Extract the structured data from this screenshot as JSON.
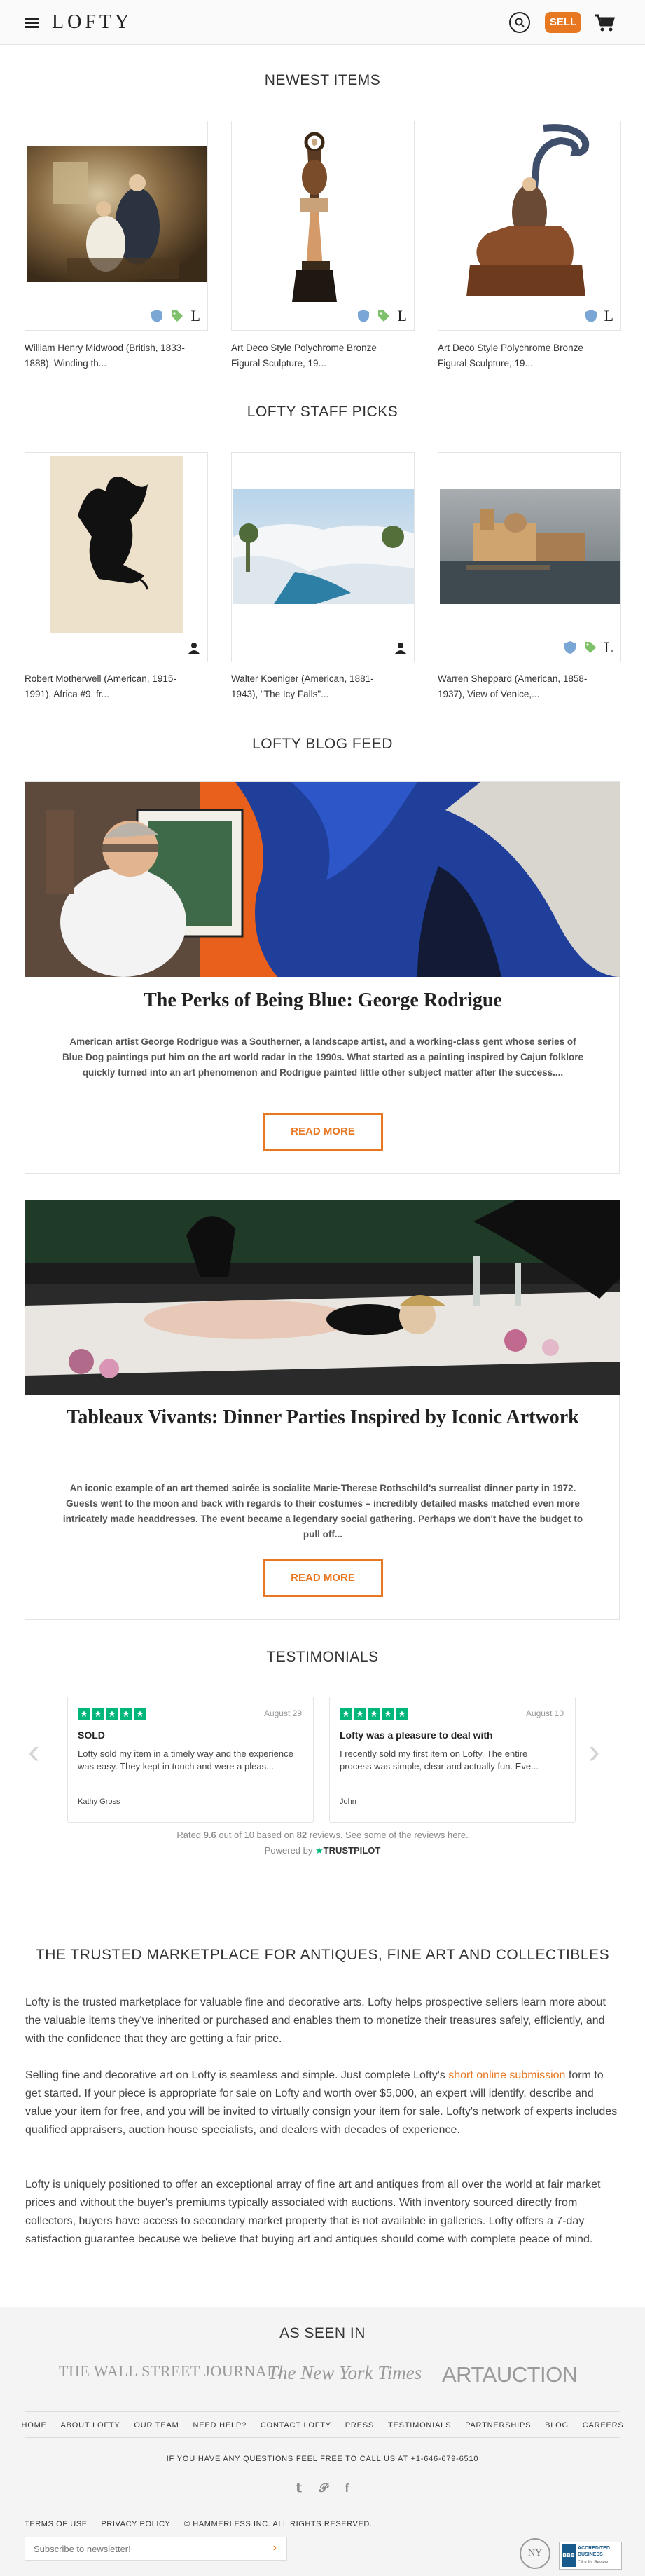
{
  "header": {
    "brand": "LOFTY",
    "sell_label": "SELL",
    "icons": [
      "menu-icon",
      "search-icon",
      "cart-icon"
    ]
  },
  "newest": {
    "title": "NEWEST ITEMS",
    "items": [
      {
        "caption_line1": "William Henry Midwood (British, 1833-",
        "caption_line2": "1888), Winding th..."
      },
      {
        "caption_line1": "Art Deco Style Polychrome Bronze",
        "caption_line2": "Figural Sculpture, 19..."
      },
      {
        "caption_line1": "Art Deco Style Polychrome Bronze",
        "caption_line2": "Figural Sculpture, 19..."
      }
    ],
    "badge_letter": "L"
  },
  "staff": {
    "title": "LOFTY STAFF PICKS",
    "items": [
      {
        "caption_line1": "Robert Motherwell (American, 1915-",
        "caption_line2": "1991), Africa #9, fr..."
      },
      {
        "caption_line1": "Walter Koeniger (American, 1881-",
        "caption_line2": "1943), \"The Icy Falls\"..."
      },
      {
        "caption_line1": "Warren Sheppard (American, 1858-",
        "caption_line2": "1937), View of Venice,..."
      }
    ]
  },
  "blog": {
    "title": "LOFTY BLOG FEED",
    "posts": [
      {
        "title": "The Perks of Being Blue: George Rodrigue",
        "excerpt": "American artist George Rodrigue was a Southerner, a landscape artist, and a working-class gent whose series of Blue Dog paintings put him on the art world radar in the 1990s. What started as a painting inspired by Cajun folklore quickly turned into an art phenomenon and Rodrigue painted little other subject matter after the success....",
        "button": "READ MORE"
      },
      {
        "title": "Tableaux Vivants: Dinner Parties Inspired by Iconic Artwork",
        "excerpt": "An iconic example of an art themed soirée is socialite Marie-Therese Rothschild's surrealist dinner party in 1972. Guests went to the moon and back with regards to their costumes – incredibly detailed masks matched even more intricately made headdresses. The event became a legendary social gathering. Perhaps we don't have the budget to pull off...",
        "button": "READ MORE"
      }
    ]
  },
  "testimonials": {
    "title": "TESTIMONIALS",
    "reviews": [
      {
        "date": "August 29",
        "title": "SOLD",
        "body": "Lofty sold my item in a timely way and the experience was easy. They kept in touch and were a pleas...",
        "name": "Kathy Gross"
      },
      {
        "date": "August 10",
        "title": "Lofty was a pleasure to deal with",
        "body": "I recently sold my first item on Lofty. The entire process was simple, clear and actually fun. Eve...",
        "name": "John"
      }
    ],
    "rated_prefix": "Rated ",
    "rating": "9.6",
    "rated_mid": " out of 10 based on ",
    "review_count": "82",
    "rated_suffix": " reviews. See some of the reviews here.",
    "powered_by": "Powered by",
    "trustpilot": "TRUSTPILOT"
  },
  "about": {
    "title": "THE TRUSTED MARKETPLACE FOR ANTIQUES, FINE ART AND COLLECTIBLES",
    "p1": "Lofty is the trusted marketplace for valuable fine and decorative arts. Lofty helps prospective sellers learn more about the valuable items they've inherited or purchased and enables them to monetize their treasures safely, efficiently, and with the confidence that they are getting a fair price.",
    "p2_before": "Selling fine and decorative art on Lofty is seamless and simple. Just complete Lofty's ",
    "p2_link": "short online submission",
    "p2_after": " form to get started. If your piece is appropriate for sale on Lofty and worth over $5,000, an expert will identify, describe and value your item for free, and you will be invited to virtually consign your item for sale. Lofty's network of experts includes qualified appraisers, auction house specialists, and dealers with decades of experience.",
    "p3": "Lofty is uniquely positioned to offer an exceptional array of fine art and antiques from all over the world at fair market prices and without the buyer's premiums typically associated with auctions. With inventory sourced directly from collectors, buyers have access to secondary market property that is not available in galleries. Lofty offers a 7-day satisfaction guarantee because we believe that buying art and antiques should come with complete peace of mind."
  },
  "footer": {
    "as_seen_in": "AS SEEN IN",
    "press": [
      "THE WALL STREET JOURNAL.",
      "The New York Times",
      "ARTAUCTION"
    ],
    "nav": [
      "HOME",
      "ABOUT LOFTY",
      "OUR TEAM",
      "NEED HELP?",
      "CONTACT LOFTY",
      "PRESS",
      "TESTIMONIALS",
      "PARTNERSHIPS",
      "BLOG",
      "CAREERS"
    ],
    "call_text": "IF YOU HAVE ANY QUESTIONS FEEL FREE TO CALL US AT +1-646-679-6510",
    "social": [
      "twitter-icon",
      "pinterest-icon",
      "facebook-icon"
    ],
    "legal": [
      "TERMS OF USE",
      "PRIVACY POLICY",
      "© HAMMERLESS INC. ALL RIGHTS RESERVED."
    ],
    "newsletter_placeholder": "Subscribe to newsletter!",
    "seal_text": "NY",
    "bbb_text": "ACCREDITED BUSINESS",
    "bbb_sub": "Click for Review",
    "bbb_logo": "BBB"
  }
}
